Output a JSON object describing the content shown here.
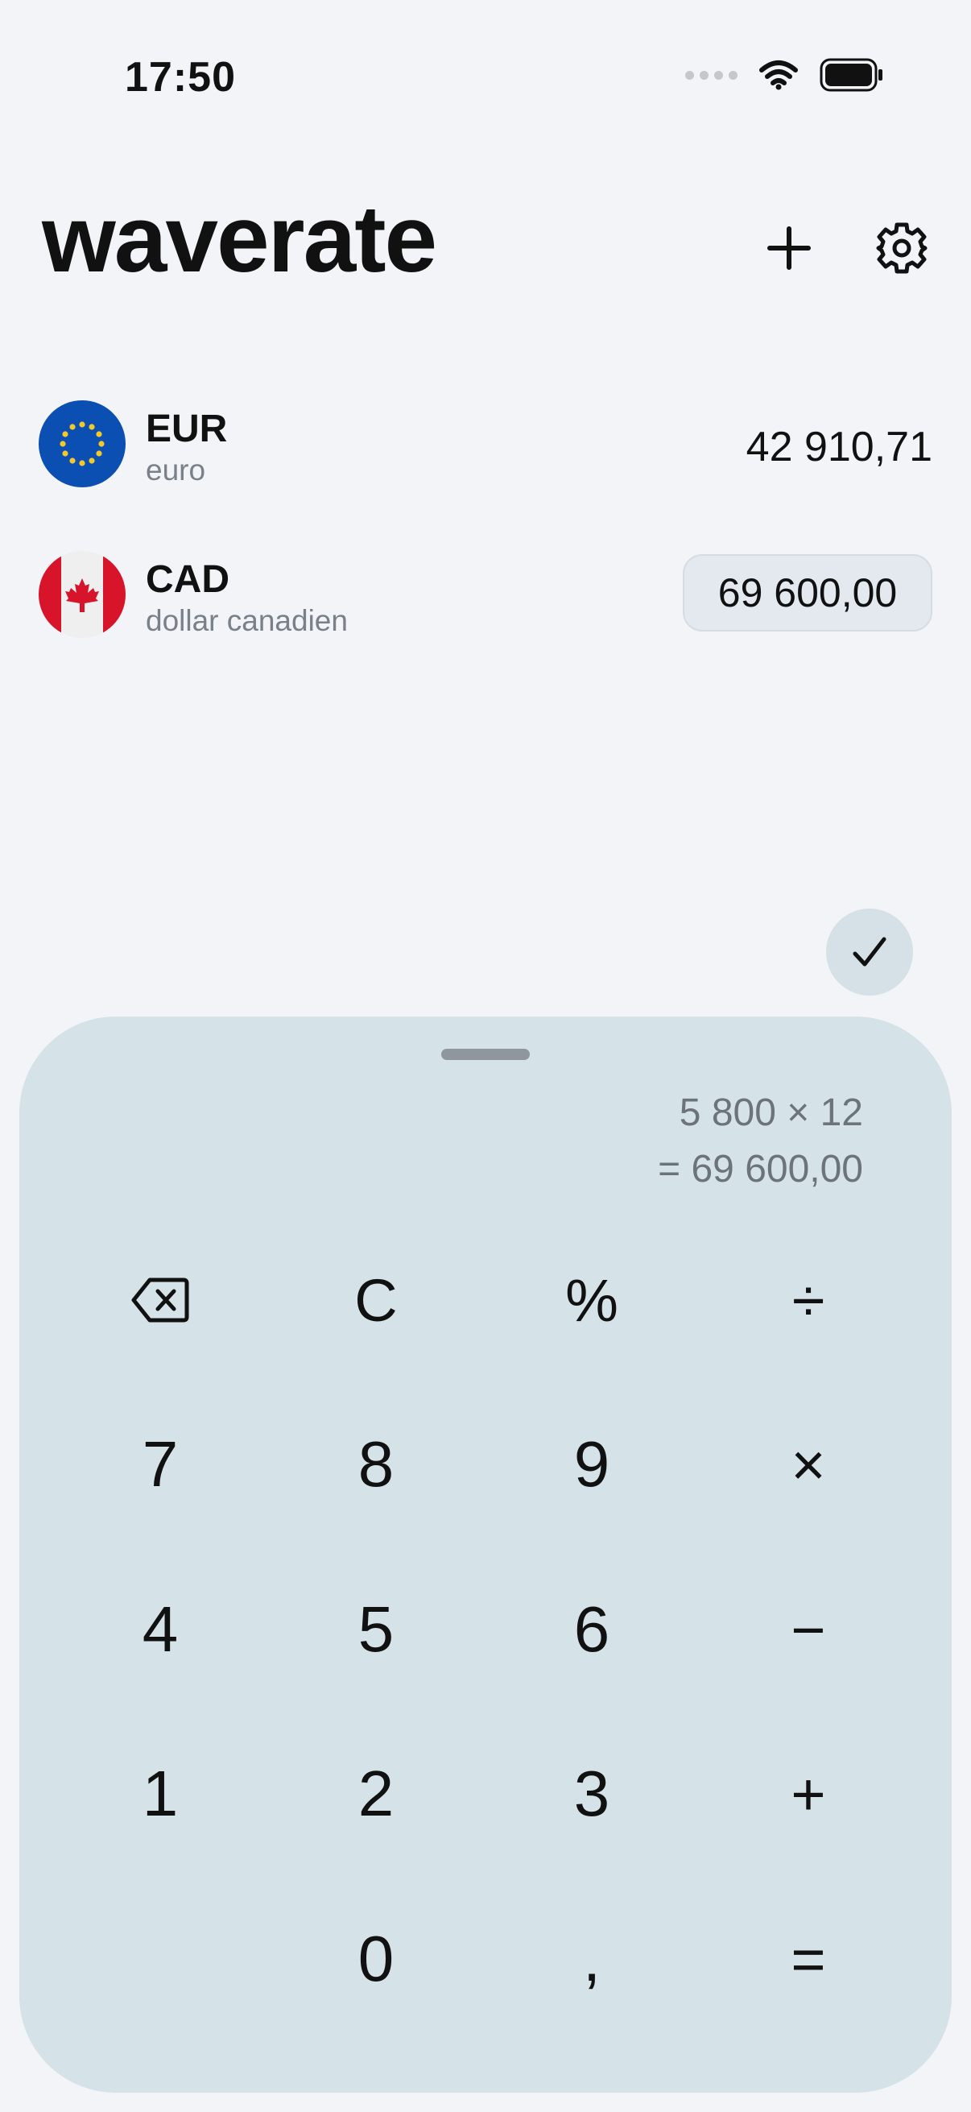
{
  "status": {
    "time": "17:50"
  },
  "app": {
    "title": "waverate"
  },
  "currencies": [
    {
      "code": "EUR",
      "name": "euro",
      "value": "42 910,71"
    },
    {
      "code": "CAD",
      "name": "dollar canadien",
      "value": "69 600,00"
    }
  ],
  "calculator": {
    "expression": "5 800 × 12",
    "result": "= 69 600,00",
    "keys": {
      "clear": "C",
      "percent": "%",
      "divide": "÷",
      "seven": "7",
      "eight": "8",
      "nine": "9",
      "multiply": "×",
      "four": "4",
      "five": "5",
      "six": "6",
      "minus": "−",
      "one": "1",
      "two": "2",
      "three": "3",
      "plus": "+",
      "zero": "0",
      "comma": ",",
      "equals": "="
    }
  },
  "colors": {
    "background": "#f2f4f7",
    "keypad": "#d5e2e8",
    "secondary_text": "#7a808a"
  }
}
